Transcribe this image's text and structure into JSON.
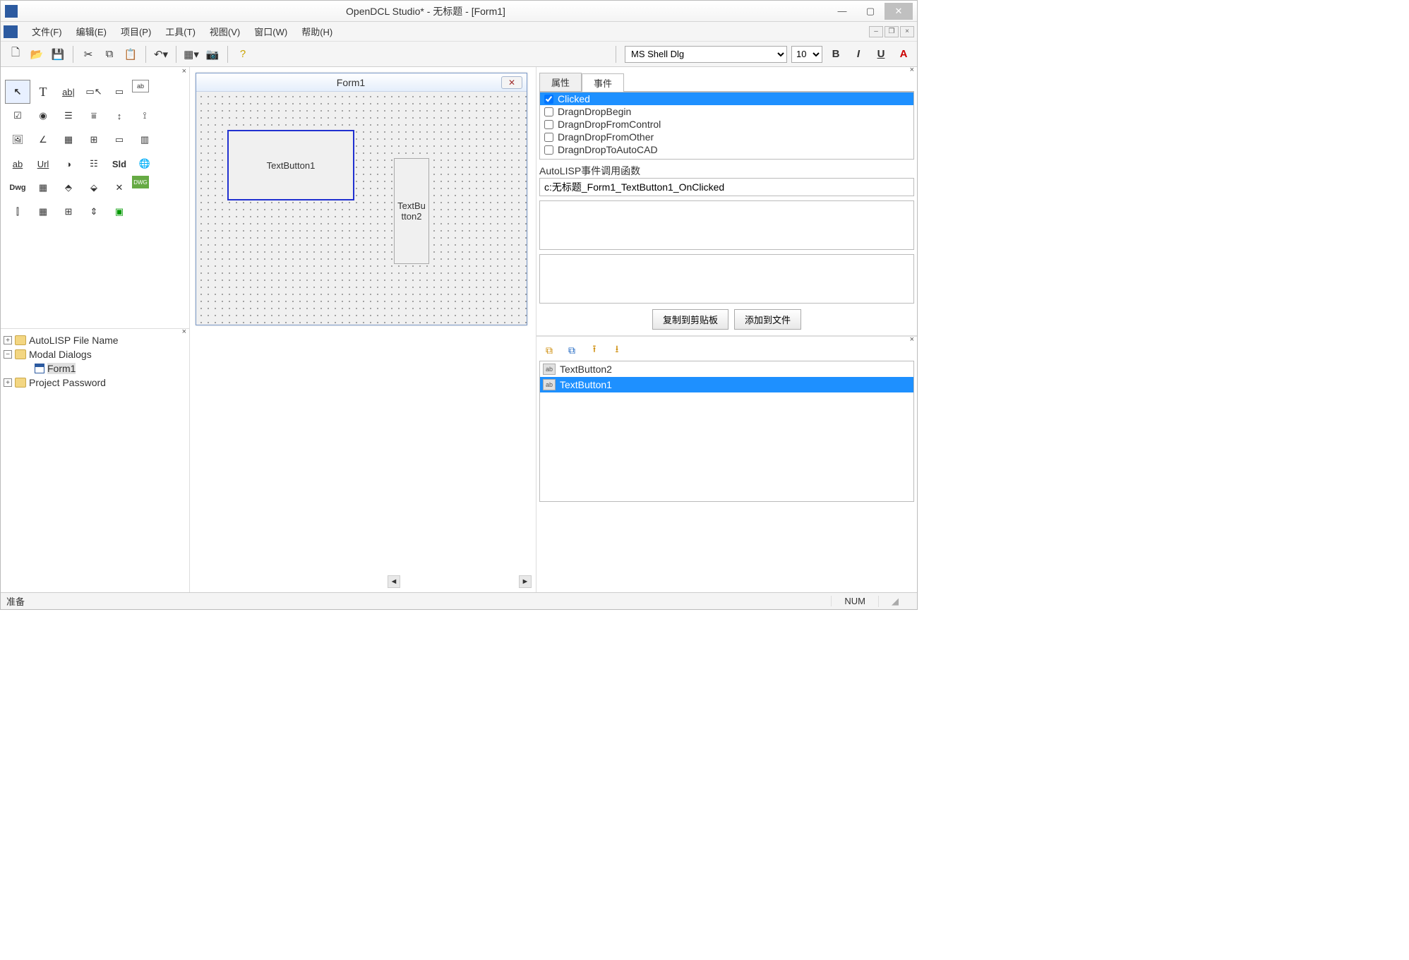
{
  "window": {
    "title": "OpenDCL Studio* - 无标题 - [Form1]"
  },
  "menu": {
    "file": "文件(F)",
    "edit": "编辑(E)",
    "project": "项目(P)",
    "tools": "工具(T)",
    "view": "视图(V)",
    "window": "窗口(W)",
    "help": "帮助(H)"
  },
  "toolbar": {
    "font_name": "MS Shell Dlg",
    "font_size": "10"
  },
  "tree": {
    "n0": "AutoLISP File Name",
    "n1": "Modal Dialogs",
    "n1_0": "Form1",
    "n2": "Project Password"
  },
  "form": {
    "title": "Form1",
    "btn1": "TextButton1",
    "btn2": "TextButton2"
  },
  "props": {
    "tab_attr": "属性",
    "tab_event": "事件",
    "events": {
      "e0": "Clicked",
      "e1": "DragnDropBegin",
      "e2": "DragnDropFromControl",
      "e3": "DragnDropFromOther",
      "e4": "DragnDropToAutoCAD"
    },
    "fn_label": "AutoLISP事件调用函数",
    "fn_value": "c:无标题_Form1_TextButton1_OnClicked",
    "btn_copy": "复制到剪贴板",
    "btn_add": "添加到文件"
  },
  "zorder": {
    "i0": "TextButton2",
    "i1": "TextButton1"
  },
  "status": {
    "ready": "准备",
    "num": "NUM"
  }
}
